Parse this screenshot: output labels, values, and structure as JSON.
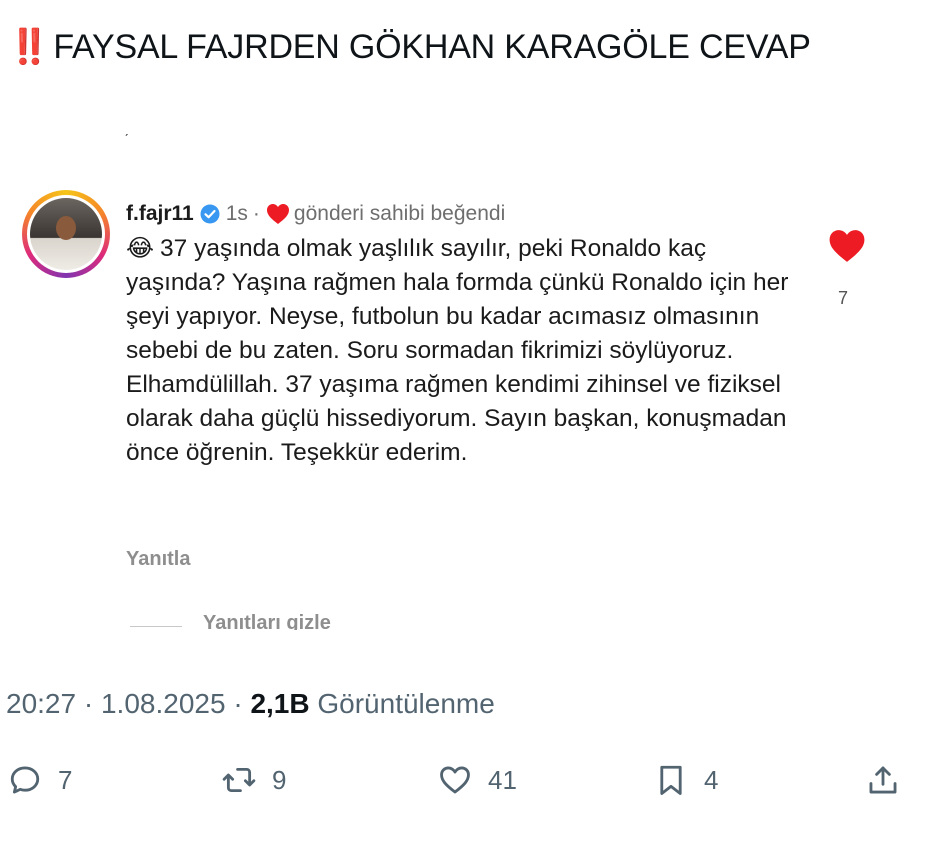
{
  "tweet": {
    "title_marks": "‼️",
    "title": "FAYSAL FAJRDEN GÖKHAN KARAGÖLE CEVAP"
  },
  "screenshot": {
    "username": "f.fajr11",
    "time": "1s",
    "separator": "·",
    "liked_by_author": "gönderi sahibi beğendi",
    "comment_emoji": "😂",
    "comment_text": "37 yaşında olmak yaşlılık sayılır, peki Ronaldo kaç yaşında? Yaşına rağmen hala formda çünkü Ronaldo için her şeyi yapıyor. Neyse, futbolun bu kadar acımasız olmasının sebebi de bu zaten. Soru sormadan fikrimizi söylüyoruz. Elhamdülillah. 37 yaşıma rağmen kendimi zihinsel ve fiziksel olarak daha güçlü hissediyorum. Sayın başkan, konuşmadan önce öğrenin. Teşekkür ederim.",
    "like_count": "7",
    "reply_label": "Yanıtla",
    "hide_replies_label": "Yanıtları gizle",
    "heart_color": "#ed1c24"
  },
  "meta": {
    "time": "20:27",
    "dot": "·",
    "date": "1.08.2025",
    "views_count": "2,1B",
    "views_label": "Görüntülenme"
  },
  "actions": {
    "replies": "7",
    "retweets": "9",
    "likes": "41",
    "bookmarks": "4"
  }
}
